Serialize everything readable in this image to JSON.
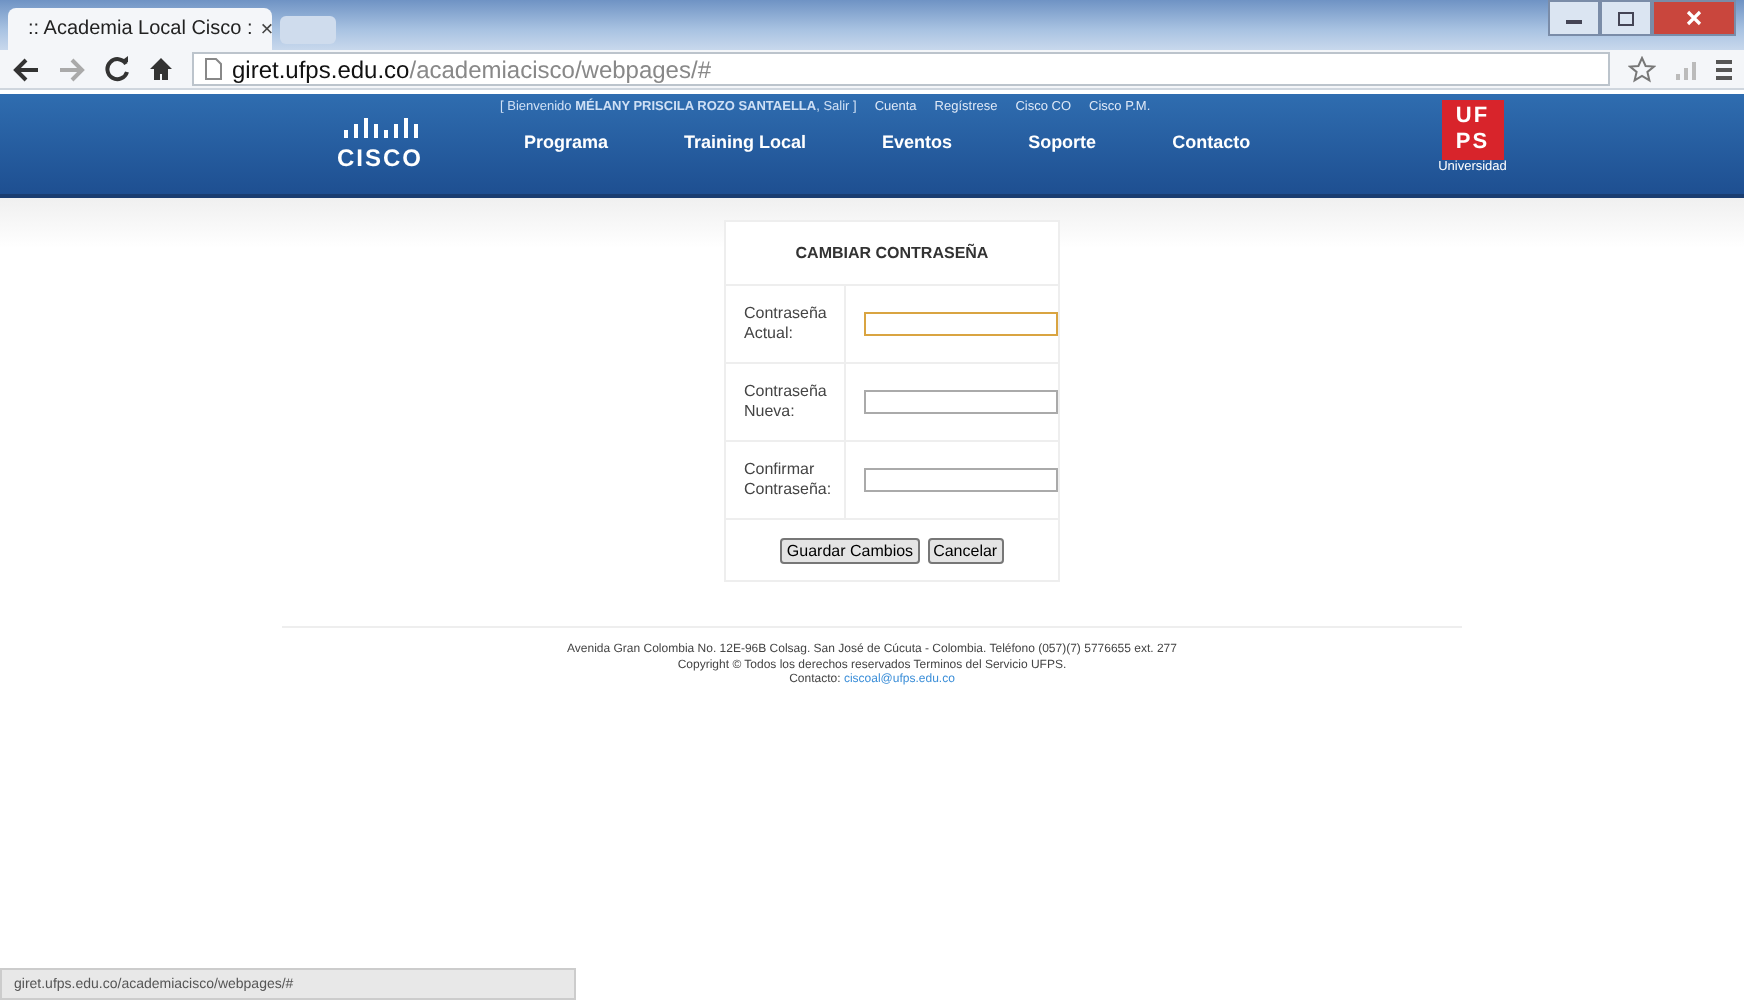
{
  "browser": {
    "tab_title": ":: Academia Local Cisco :",
    "tab_close": "×",
    "url_host": "giret.ufps.edu.co",
    "url_path": "/academiacisco/webpages/#"
  },
  "header": {
    "logo_text": "CISCO",
    "welcome": "[ Bienvenido **MÉLANY PRISCILA ROZO SANTAELLA**, Salir ]",
    "top_links": [
      "Cuenta",
      "Regístrese",
      "Cisco CO",
      "Cisco P.M."
    ],
    "nav": [
      "Programa",
      "Training Local",
      "Eventos",
      "Soporte",
      "Contacto"
    ],
    "badge": {
      "top": "UF",
      "bottom": "PS",
      "caption": "Universidad"
    }
  },
  "form": {
    "title": "CAMBIAR CONTRASEÑA",
    "fields": [
      {
        "label": "Contraseña Actual:",
        "focused": true
      },
      {
        "label": "Contraseña Nueva:",
        "focused": false
      },
      {
        "label": "Confirmar Contraseña:",
        "focused": false
      }
    ],
    "buttons": [
      "Guardar Cambios",
      "Cancelar"
    ]
  },
  "footer": {
    "address": "Avenida Gran Colombia No. 12E-96B Colsag. San José de Cúcuta - Colombia. Teléfono (057)(7) 5776655 ext. 277",
    "copyright": "Copyright © Todos los derechos reservados Terminos del Servicio UFPS.",
    "contact_label": "Contacto:",
    "contact_email": "ciscoal@ufps.edu.co"
  },
  "status_bar": "giret.ufps.edu.co/academiacisco/webpages/#"
}
